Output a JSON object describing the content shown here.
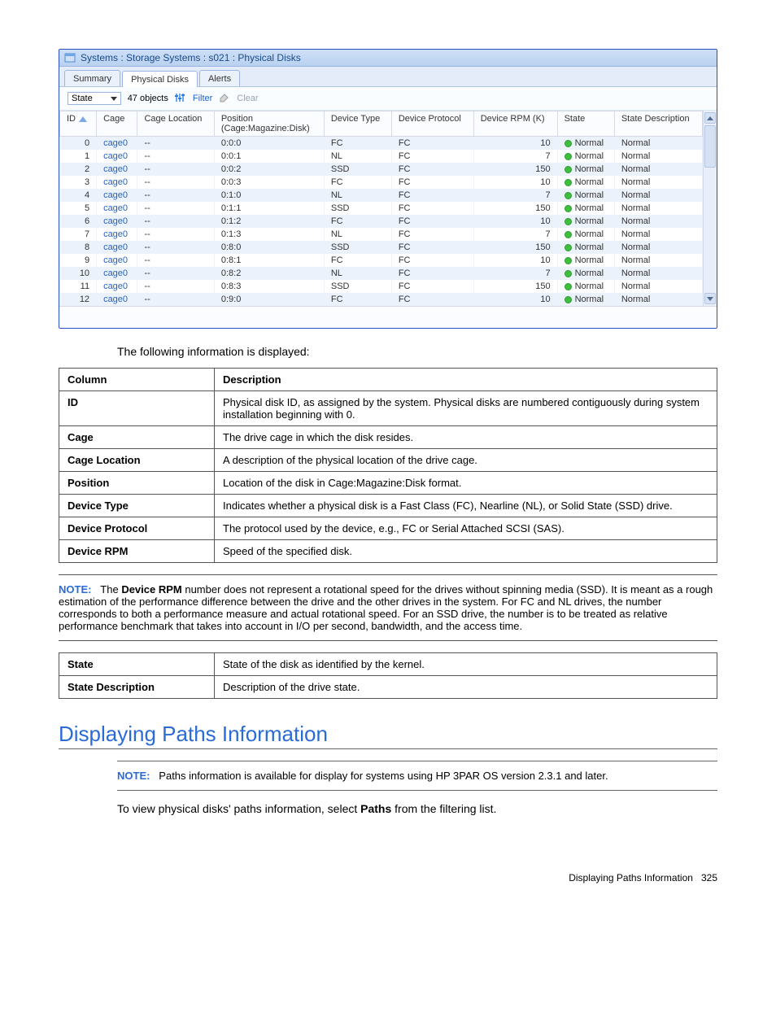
{
  "window": {
    "title": "Systems : Storage Systems : s021 : Physical Disks",
    "tabs": [
      "Summary",
      "Physical Disks",
      "Alerts"
    ],
    "active_tab": 1,
    "filter": {
      "state_label": "State",
      "object_count": "47 objects",
      "filter_label": "Filter",
      "clear_label": "Clear"
    },
    "columns": {
      "id": "ID",
      "cage": "Cage",
      "cage_loc": "Cage Location",
      "position": "Position",
      "position_sub": "(Cage:Magazine:Disk)",
      "dev_type": "Device Type",
      "dev_proto": "Device Protocol",
      "dev_rpm": "Device RPM (K)",
      "state": "State",
      "state_desc": "State Description"
    },
    "rows": [
      {
        "id": "0",
        "cage": "cage0",
        "loc": "--",
        "pos": "0:0:0",
        "type": "FC",
        "proto": "FC",
        "rpm": "10",
        "state": "Normal",
        "desc": "Normal"
      },
      {
        "id": "1",
        "cage": "cage0",
        "loc": "--",
        "pos": "0:0:1",
        "type": "NL",
        "proto": "FC",
        "rpm": "7",
        "state": "Normal",
        "desc": "Normal"
      },
      {
        "id": "2",
        "cage": "cage0",
        "loc": "--",
        "pos": "0:0:2",
        "type": "SSD",
        "proto": "FC",
        "rpm": "150",
        "state": "Normal",
        "desc": "Normal"
      },
      {
        "id": "3",
        "cage": "cage0",
        "loc": "--",
        "pos": "0:0:3",
        "type": "FC",
        "proto": "FC",
        "rpm": "10",
        "state": "Normal",
        "desc": "Normal"
      },
      {
        "id": "4",
        "cage": "cage0",
        "loc": "--",
        "pos": "0:1:0",
        "type": "NL",
        "proto": "FC",
        "rpm": "7",
        "state": "Normal",
        "desc": "Normal"
      },
      {
        "id": "5",
        "cage": "cage0",
        "loc": "--",
        "pos": "0:1:1",
        "type": "SSD",
        "proto": "FC",
        "rpm": "150",
        "state": "Normal",
        "desc": "Normal"
      },
      {
        "id": "6",
        "cage": "cage0",
        "loc": "--",
        "pos": "0:1:2",
        "type": "FC",
        "proto": "FC",
        "rpm": "10",
        "state": "Normal",
        "desc": "Normal"
      },
      {
        "id": "7",
        "cage": "cage0",
        "loc": "--",
        "pos": "0:1:3",
        "type": "NL",
        "proto": "FC",
        "rpm": "7",
        "state": "Normal",
        "desc": "Normal"
      },
      {
        "id": "8",
        "cage": "cage0",
        "loc": "--",
        "pos": "0:8:0",
        "type": "SSD",
        "proto": "FC",
        "rpm": "150",
        "state": "Normal",
        "desc": "Normal"
      },
      {
        "id": "9",
        "cage": "cage0",
        "loc": "--",
        "pos": "0:8:1",
        "type": "FC",
        "proto": "FC",
        "rpm": "10",
        "state": "Normal",
        "desc": "Normal"
      },
      {
        "id": "10",
        "cage": "cage0",
        "loc": "--",
        "pos": "0:8:2",
        "type": "NL",
        "proto": "FC",
        "rpm": "7",
        "state": "Normal",
        "desc": "Normal"
      },
      {
        "id": "11",
        "cage": "cage0",
        "loc": "--",
        "pos": "0:8:3",
        "type": "SSD",
        "proto": "FC",
        "rpm": "150",
        "state": "Normal",
        "desc": "Normal"
      },
      {
        "id": "12",
        "cage": "cage0",
        "loc": "--",
        "pos": "0:9:0",
        "type": "FC",
        "proto": "FC",
        "rpm": "10",
        "state": "Normal",
        "desc": "Normal"
      }
    ]
  },
  "intro_text": "The following information is displayed:",
  "def_header": {
    "col": "Column",
    "desc": "Description"
  },
  "defs": [
    {
      "col": "ID",
      "desc": "Physical disk ID, as assigned by the system. Physical disks are numbered contiguously during system installation beginning with 0."
    },
    {
      "col": "Cage",
      "desc": "The drive cage in which the disk resides."
    },
    {
      "col": "Cage Location",
      "desc": "A description of the physical location of the drive cage."
    },
    {
      "col": "Position",
      "desc": "Location of the disk in Cage:Magazine:Disk format."
    },
    {
      "col": "Device Type",
      "desc": "Indicates whether a physical disk is a Fast Class (FC), Nearline (NL), or Solid State (SSD) drive."
    },
    {
      "col": "Device Protocol",
      "desc": "The protocol used by the device, e.g., FC or Serial Attached SCSI (SAS)."
    },
    {
      "col": "Device RPM",
      "desc": "Speed of the specified disk."
    }
  ],
  "note1": {
    "label": "NOTE:",
    "pre": "The ",
    "bold": "Device RPM",
    "text": " number does not represent a rotational speed for the drives without spinning media (SSD). It is meant as a rough estimation of the performance difference between the drive and the other drives in the system. For FC and NL drives, the number corresponds to both a performance measure and actual rotational speed. For an SSD drive, the number is to be treated as relative performance benchmark that takes into account in I/O per second, bandwidth, and the access time."
  },
  "defs2": [
    {
      "col": "State",
      "desc": "State of the disk as identified by the kernel."
    },
    {
      "col": "State Description",
      "desc": "Description of the drive state."
    }
  ],
  "section_heading": "Displaying Paths Information",
  "note2": {
    "label": "NOTE:",
    "text": "Paths information is available for display for systems using HP 3PAR OS version 2.3.1 and later."
  },
  "paths_text": {
    "pre": "To view physical disks' paths information, select ",
    "bold": "Paths",
    "post": " from the filtering list."
  },
  "footer": {
    "text": "Displaying Paths Information",
    "page": "325"
  }
}
